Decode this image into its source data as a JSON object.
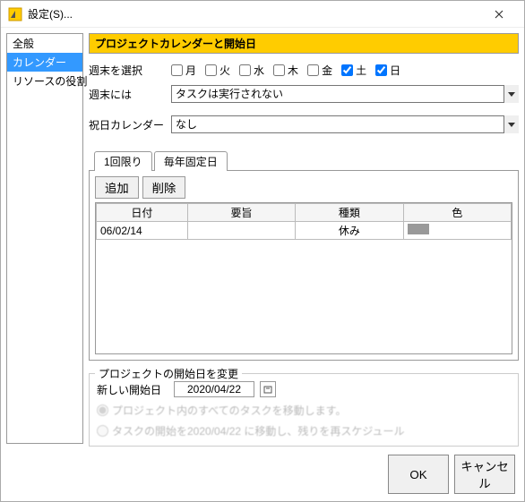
{
  "window": {
    "title": "設定(S)..."
  },
  "sidebar": {
    "items": [
      {
        "label": "全般"
      },
      {
        "label": "カレンダー"
      },
      {
        "label": "リソースの役割"
      }
    ],
    "selected_index": 1
  },
  "section": {
    "title": "プロジェクトカレンダーと開始日"
  },
  "weekend_select": {
    "label": "週末を選択",
    "days": [
      {
        "label": "月",
        "checked": false
      },
      {
        "label": "火",
        "checked": false
      },
      {
        "label": "水",
        "checked": false
      },
      {
        "label": "木",
        "checked": false
      },
      {
        "label": "金",
        "checked": false
      },
      {
        "label": "土",
        "checked": true
      },
      {
        "label": "日",
        "checked": true
      }
    ]
  },
  "weekend_action": {
    "label": "週末には",
    "value": "タスクは実行されない"
  },
  "holiday_calendar": {
    "label": "祝日カレンダー",
    "value": "なし"
  },
  "tabs": {
    "items": [
      {
        "label": "1回限り"
      },
      {
        "label": "毎年固定日"
      }
    ],
    "active_index": 0
  },
  "buttons": {
    "add": "追加",
    "delete": "削除"
  },
  "table": {
    "headers": {
      "date": "日付",
      "summary": "要旨",
      "type": "種類",
      "color": "色"
    },
    "rows": [
      {
        "date": "06/02/14",
        "summary": "",
        "type": "休み",
        "color": "#999999"
      }
    ]
  },
  "start_date_group": {
    "title": "プロジェクトの開始日を変更",
    "label": "新しい開始日",
    "value": "2020/04/22",
    "option1": "プロジェクト内のすべてのタスクを移動します。",
    "option2": "タスクの開始を2020/04/22 に移動し、残りを再スケジュール"
  },
  "dialog": {
    "ok": "OK",
    "cancel": "キャンセル"
  }
}
